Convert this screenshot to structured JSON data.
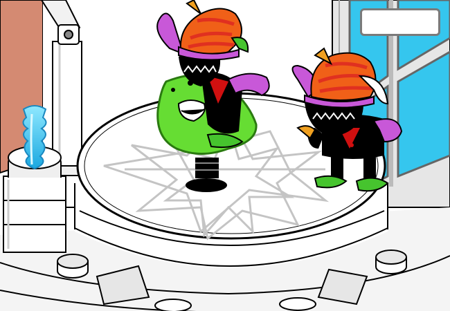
{
  "scene": {
    "title": "",
    "hud_text": "",
    "colors": {
      "wall": "#d48a72",
      "window": "#35c6ee",
      "window_frame": "#d8d8d8",
      "platform": "#ffffff",
      "outline": "#000000",
      "star_lines": "#c4c4c4",
      "crystal": "#33c8f0",
      "body": "#000000",
      "hat_orange": "#f06018",
      "hat_red": "#e03020",
      "sleeve_purple": "#c858d8",
      "shoe_green": "#46c42e",
      "ball_green": "#66dd33",
      "collar_red": "#d01010"
    },
    "characters": [
      {
        "name": "jester-on-bouncy-ball",
        "icon": "jester-icon"
      },
      {
        "name": "jester-standing",
        "icon": "jester-icon"
      }
    ],
    "props": [
      "crystal-pedestal",
      "pipe-column",
      "summoning-platform",
      "star-sigil"
    ]
  }
}
